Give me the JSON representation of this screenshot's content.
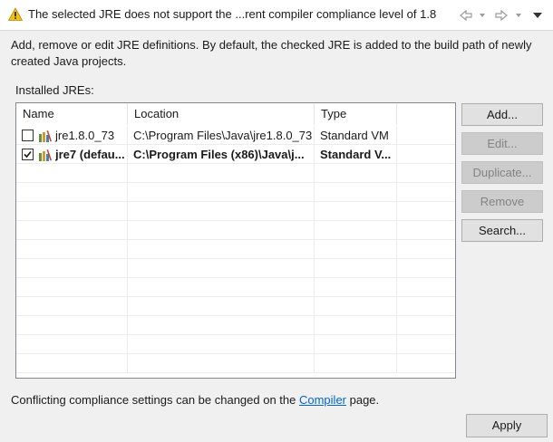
{
  "header": {
    "message": "The selected JRE does not support the ...rent compiler compliance level of 1.8",
    "icon": "warning-icon"
  },
  "description": "Add, remove or edit JRE definitions. By default, the checked JRE is added to the build path of newly created Java projects.",
  "installed_label": "Installed JREs:",
  "table": {
    "columns": [
      "Name",
      "Location",
      "Type"
    ],
    "rows": [
      {
        "checked": false,
        "name": "jre1.8.0_73",
        "location": "C:\\Program Files\\Java\\jre1.8.0_73",
        "type": "Standard VM",
        "bold": false
      },
      {
        "checked": true,
        "name": "jre7 (defau...",
        "location": "C:\\Program Files (x86)\\Java\\j...",
        "type": "Standard V...",
        "bold": true
      }
    ]
  },
  "buttons": {
    "add": "Add...",
    "edit": "Edit...",
    "duplicate": "Duplicate...",
    "remove": "Remove",
    "search": "Search..."
  },
  "footer": {
    "before": "Conflicting compliance settings can be changed on the ",
    "link": "Compiler",
    "after": " page."
  },
  "apply_label": "Apply",
  "colors": {
    "link": "#0066cc",
    "warning": "#f2c01c",
    "disabled_button": "#cccccc"
  }
}
